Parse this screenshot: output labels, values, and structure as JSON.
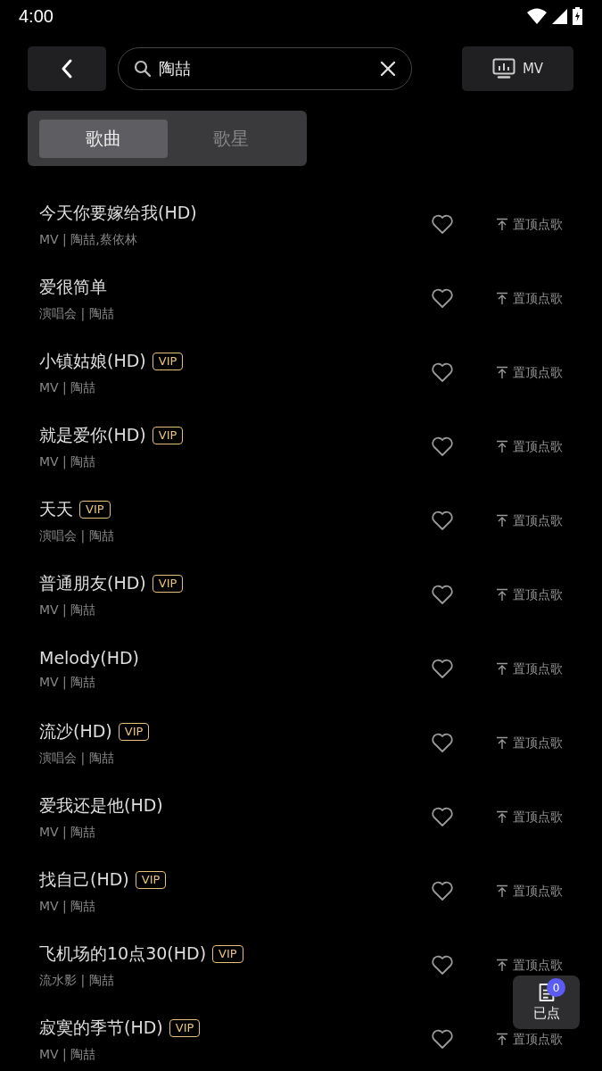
{
  "status_bar": {
    "time": "4:00"
  },
  "search": {
    "value": "陶喆"
  },
  "mv_button": {
    "label": "MV"
  },
  "tabs": [
    {
      "label": "歌曲",
      "selected": true
    },
    {
      "label": "歌星",
      "selected": false
    }
  ],
  "songs": [
    {
      "title": "今天你要嫁给我(HD)",
      "subtitle": "MV | 陶喆,蔡依林",
      "action": "置顶点歌"
    },
    {
      "title": "爱很简单",
      "subtitle": "演唱会 | 陶喆",
      "action": "置顶点歌"
    },
    {
      "title": "小镇姑娘(HD)",
      "badge": "VIP",
      "subtitle": "MV | 陶喆",
      "action": "置顶点歌"
    },
    {
      "title": "就是爱你(HD)",
      "badge": "VIP",
      "subtitle": "MV | 陶喆",
      "action": "置顶点歌"
    },
    {
      "title": "天天",
      "badge": "VIP",
      "subtitle": "演唱会 | 陶喆",
      "action": "置顶点歌"
    },
    {
      "title": "普通朋友(HD)",
      "badge": "VIP",
      "subtitle": "MV | 陶喆",
      "action": "置顶点歌"
    },
    {
      "title": "Melody(HD)",
      "subtitle": "MV | 陶喆",
      "action": "置顶点歌"
    },
    {
      "title": "流沙(HD)",
      "badge": "VIP",
      "subtitle": "演唱会 | 陶喆",
      "action": "置顶点歌"
    },
    {
      "title": "爱我还是他(HD)",
      "subtitle": "MV | 陶喆",
      "action": "置顶点歌"
    },
    {
      "title": "找自己(HD)",
      "badge": "VIP",
      "subtitle": "MV | 陶喆",
      "action": "置顶点歌"
    },
    {
      "title": "飞机场的10点30(HD)",
      "badge": "VIP",
      "subtitle": "流水影 | 陶喆",
      "action": "置顶点歌"
    },
    {
      "title": "寂寞的季节(HD)",
      "badge": "VIP",
      "subtitle": "MV | 陶喆",
      "action": "置顶点歌"
    }
  ],
  "queue_button": {
    "label": "已点",
    "count": "0"
  }
}
